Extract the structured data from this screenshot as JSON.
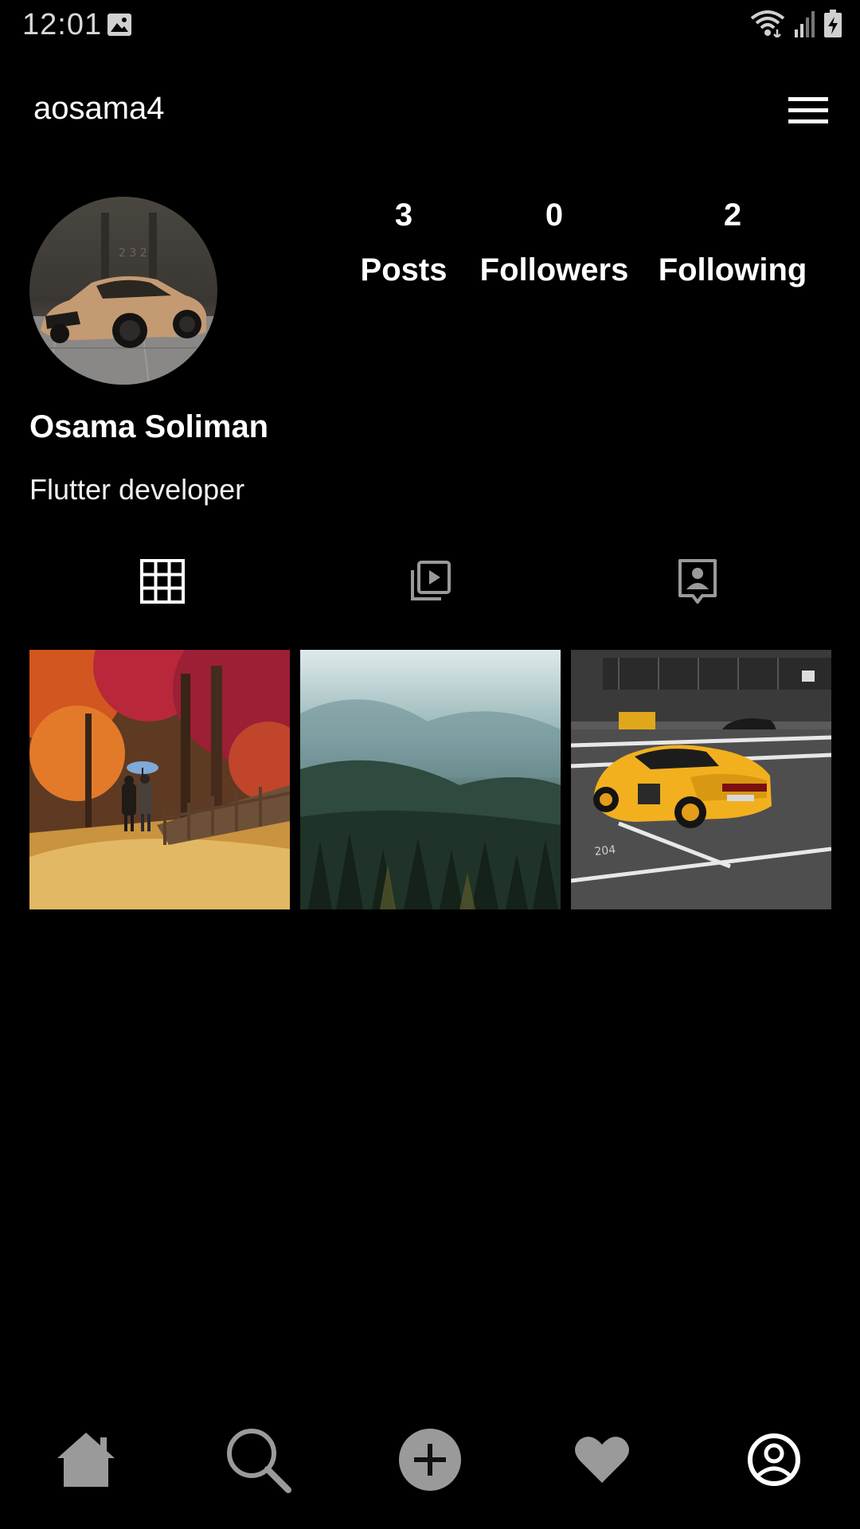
{
  "status_bar": {
    "time": "12:01",
    "icons": [
      "image-icon",
      "wifi-icon",
      "signal-icon",
      "battery-charging-icon"
    ]
  },
  "app_bar": {
    "username": "aosama4",
    "menu_icon": "hamburger-menu-icon"
  },
  "profile": {
    "display_name": "Osama Soliman",
    "bio": "Flutter developer",
    "avatar": "car-photo-avatar",
    "stats": {
      "posts": {
        "value": "3",
        "label": "Posts"
      },
      "followers": {
        "value": "0",
        "label": "Followers"
      },
      "following": {
        "value": "2",
        "label": "Following"
      }
    }
  },
  "tabs": [
    {
      "icon": "grid-icon",
      "active": true
    },
    {
      "icon": "reels-icon",
      "active": false
    },
    {
      "icon": "tagged-icon",
      "active": false
    }
  ],
  "posts": [
    {
      "image": "autumn-park-couple-umbrella"
    },
    {
      "image": "misty-pine-forest-valley"
    },
    {
      "image": "yellow-sports-car-parking"
    }
  ],
  "bottom_nav": [
    {
      "icon": "home-icon",
      "active": false
    },
    {
      "icon": "search-icon",
      "active": false
    },
    {
      "icon": "add-icon",
      "active": false
    },
    {
      "icon": "heart-icon",
      "active": false
    },
    {
      "icon": "profile-icon",
      "active": true
    }
  ],
  "colors": {
    "background": "#000000",
    "text": "#ffffff",
    "inactive_icon": "#9a9a9a",
    "active_icon": "#ffffff"
  }
}
